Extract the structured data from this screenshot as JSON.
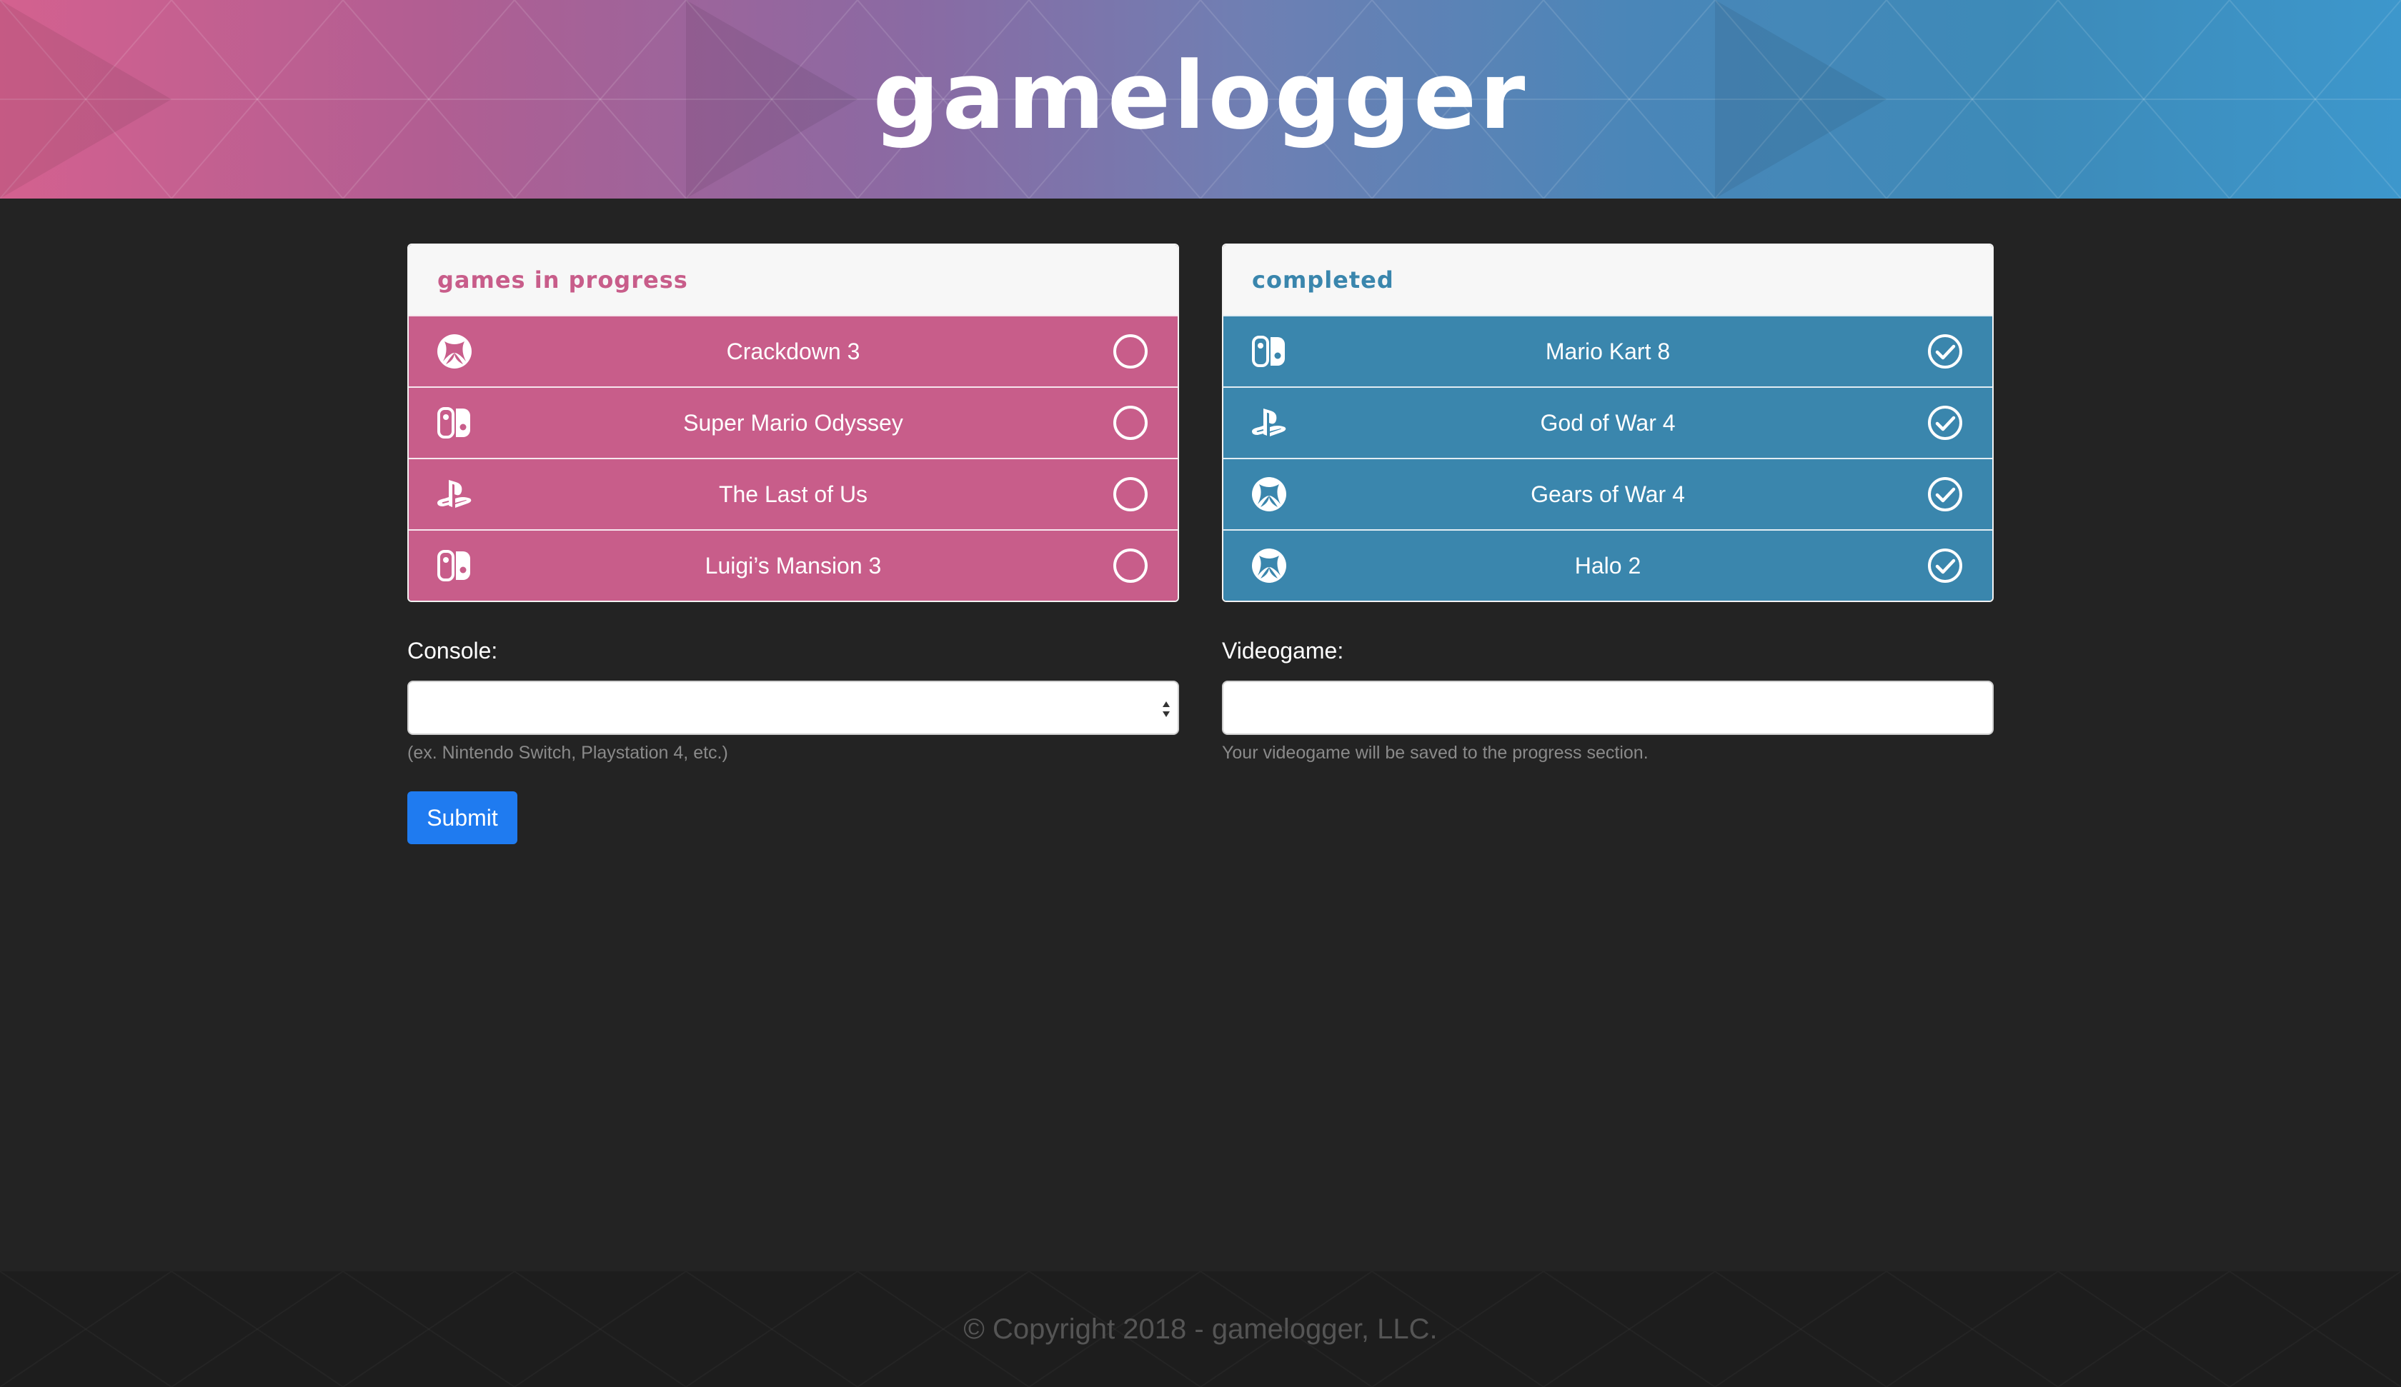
{
  "app": {
    "logo": "gamelogger",
    "colors": {
      "progress": "#c85d8a",
      "completed": "#3a86ad",
      "submit": "#1f7bf0",
      "background": "#232323"
    }
  },
  "progress": {
    "title": "games in progress",
    "games": [
      {
        "console": "xbox-icon",
        "title": "Crackdown 3",
        "status": "circle-icon"
      },
      {
        "console": "nintendo-switch-icon",
        "title": "Super Mario Odyssey",
        "status": "circle-icon"
      },
      {
        "console": "playstation-icon",
        "title": "The Last of Us",
        "status": "circle-icon"
      },
      {
        "console": "nintendo-switch-icon",
        "title": "Luigi’s Mansion 3",
        "status": "circle-icon"
      }
    ]
  },
  "completed": {
    "title": "completed",
    "games": [
      {
        "console": "nintendo-switch-icon",
        "title": "Mario Kart 8",
        "status": "check-circle-icon"
      },
      {
        "console": "playstation-icon",
        "title": "God of War 4",
        "status": "check-circle-icon"
      },
      {
        "console": "xbox-icon",
        "title": "Gears of War 4",
        "status": "check-circle-icon"
      },
      {
        "console": "xbox-icon",
        "title": "Halo 2",
        "status": "check-circle-icon"
      }
    ]
  },
  "form": {
    "console_label": "Console:",
    "console_value": "",
    "console_hint": "(ex. Nintendo Switch, Playstation 4, etc.)",
    "videogame_label": "Videogame:",
    "videogame_value": "",
    "videogame_hint": "Your videogame will be saved to the progress section.",
    "submit_label": "Submit"
  },
  "footer": {
    "copyright": "© Copyright 2018 - gamelogger, LLC."
  }
}
